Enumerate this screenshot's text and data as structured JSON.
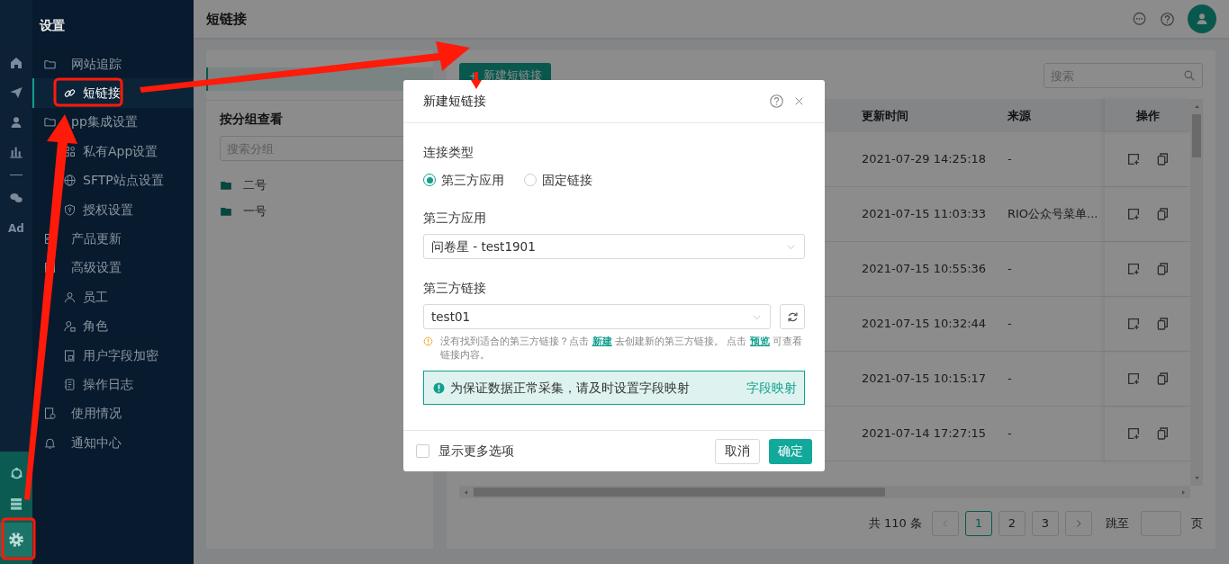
{
  "rail": {
    "text_item": "Ad"
  },
  "sidebar": {
    "title": "设置",
    "items": [
      {
        "kind": "folder",
        "label": "网站追踪",
        "selected": false,
        "children": [
          {
            "kind": "link",
            "label": "短链接",
            "selected": true
          }
        ]
      },
      {
        "kind": "folder",
        "label": "pp集成设置",
        "selected": false,
        "children": [
          {
            "kind": "app",
            "label": "私有App设置",
            "selected": false
          },
          {
            "kind": "globe",
            "label": "SFTP站点设置",
            "selected": false
          },
          {
            "kind": "shield",
            "label": "授权设置",
            "selected": false
          }
        ]
      },
      {
        "kind": "product",
        "label": "产品更新",
        "selected": false
      },
      {
        "kind": "advanced",
        "label": "高级设置",
        "selected": false,
        "children": [
          {
            "kind": "user",
            "label": "员工",
            "selected": false
          },
          {
            "kind": "role",
            "label": "角色",
            "selected": false
          },
          {
            "kind": "encrypt",
            "label": "用户字段加密",
            "selected": false
          },
          {
            "kind": "log",
            "label": "操作日志",
            "selected": false
          }
        ]
      },
      {
        "kind": "usage",
        "label": "使用情况",
        "selected": false
      },
      {
        "kind": "bell",
        "label": "通知中心",
        "selected": false
      }
    ]
  },
  "header": {
    "title": "短链接"
  },
  "groups_panel": {
    "all_item": {
      "selected": true
    },
    "heading": "按分组查看",
    "search": {
      "placeholder": "搜索分组"
    },
    "groups": [
      {
        "label": "二号"
      },
      {
        "label": "一号"
      }
    ]
  },
  "list_panel": {
    "new_button": "新建短链接",
    "search": {
      "placeholder": "搜索"
    },
    "table": {
      "columns": [
        "更新时间",
        "来源",
        "操作"
      ],
      "rows": [
        {
          "updated": "2021-07-29 14:25:18",
          "source": "-"
        },
        {
          "updated": "2021-07-15 11:03:33",
          "source": "RIO公众号菜单..."
        },
        {
          "updated": "2021-07-15 10:55:36",
          "source": "-"
        },
        {
          "updated": "2021-07-15 10:32:44",
          "source": "-"
        },
        {
          "updated": "2021-07-15 10:15:17",
          "source": "-"
        },
        {
          "updated": "2021-07-14 17:27:15",
          "source": "-"
        }
      ]
    },
    "pagination": {
      "total": "共 110 条",
      "pages": [
        {
          "label": "1",
          "selected": true
        },
        {
          "label": "2",
          "selected": false
        },
        {
          "label": "3",
          "selected": false
        }
      ],
      "jump_label": "跳至",
      "page_suffix": "页"
    }
  },
  "dialog": {
    "title": "新建短链接",
    "type_label": "连接类型",
    "type_options": [
      {
        "label": "第三方应用",
        "selected": true
      },
      {
        "label": "固定链接",
        "selected": false
      }
    ],
    "app_label": "第三方应用",
    "app_value": "问卷星 - test1901",
    "link_label": "第三方链接",
    "link_value": "test01",
    "hint": [
      {
        "kind": "text",
        "text": "没有找到适合的第三方链接？点击 "
      },
      {
        "kind": "link",
        "text": "新建"
      },
      {
        "kind": "text",
        "text": " 去创建新的第三方链接。 点击 "
      },
      {
        "kind": "link",
        "text": "预览"
      },
      {
        "kind": "text",
        "text": " 可查看链接内容。"
      }
    ],
    "alert": {
      "text": "为保证数据正常采集，请及时设置字段映射",
      "action": "字段映射"
    },
    "more_options": {
      "label": "显示更多选项",
      "checked": false
    },
    "cancel": "取消",
    "ok": "确定"
  }
}
